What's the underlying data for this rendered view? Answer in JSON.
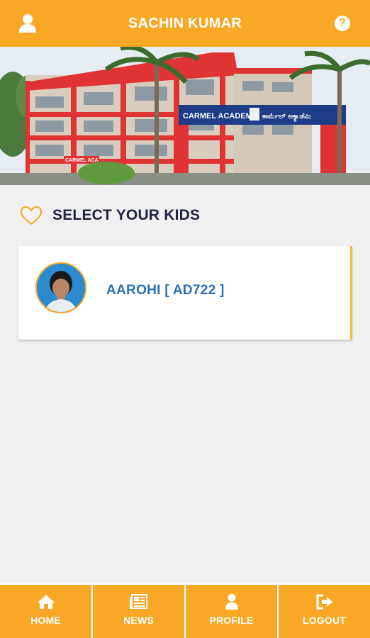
{
  "header": {
    "title": "SACHIN KUMAR"
  },
  "banner": {
    "sign_text": "CARMEL ACADEMY",
    "sign_text_local": "ಕಾರ್ಮೆಲ್ ಅಕ್ಯಾಡೆಮಿ",
    "small_sign": "CARMEL ACA"
  },
  "section": {
    "title": "SELECT YOUR KIDS"
  },
  "kids": [
    {
      "label": "AAROHI [ AD722 ]"
    }
  ],
  "nav": [
    {
      "label": "HOME",
      "icon": "home-icon"
    },
    {
      "label": "NEWS",
      "icon": "news-icon"
    },
    {
      "label": "PROFILE",
      "icon": "profile-icon"
    },
    {
      "label": "LOGOUT",
      "icon": "logout-icon"
    }
  ],
  "colors": {
    "accent": "#f9a825",
    "heading": "#1f2340",
    "link": "#2a6fb5",
    "background": "#f0f0f0"
  }
}
